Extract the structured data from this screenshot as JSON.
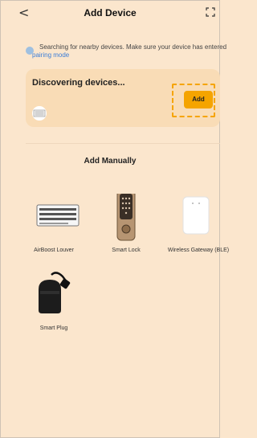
{
  "header": {
    "back_label": "<",
    "title": "Add Device",
    "scan_icon": "scan-icon"
  },
  "hint": {
    "text": "Searching for nearby devices. Make sure your device has entered",
    "link": "pairing mode"
  },
  "discover": {
    "title": "Discovering devices...",
    "add_label": "Add"
  },
  "manual": {
    "title": "Add Manually",
    "devices": [
      {
        "label": "AirBoost Louver",
        "icon": "louver-icon"
      },
      {
        "label": "Smart Lock",
        "icon": "lock-icon"
      },
      {
        "label": "Wireless Gateway (BLE)",
        "icon": "gateway-icon"
      },
      {
        "label": "Smart Plug",
        "icon": "plug-icon"
      }
    ]
  },
  "colors": {
    "background": "#fbe6cd",
    "card": "#f9dcb6",
    "accent": "#f5a400",
    "link": "#3b7dd8"
  }
}
